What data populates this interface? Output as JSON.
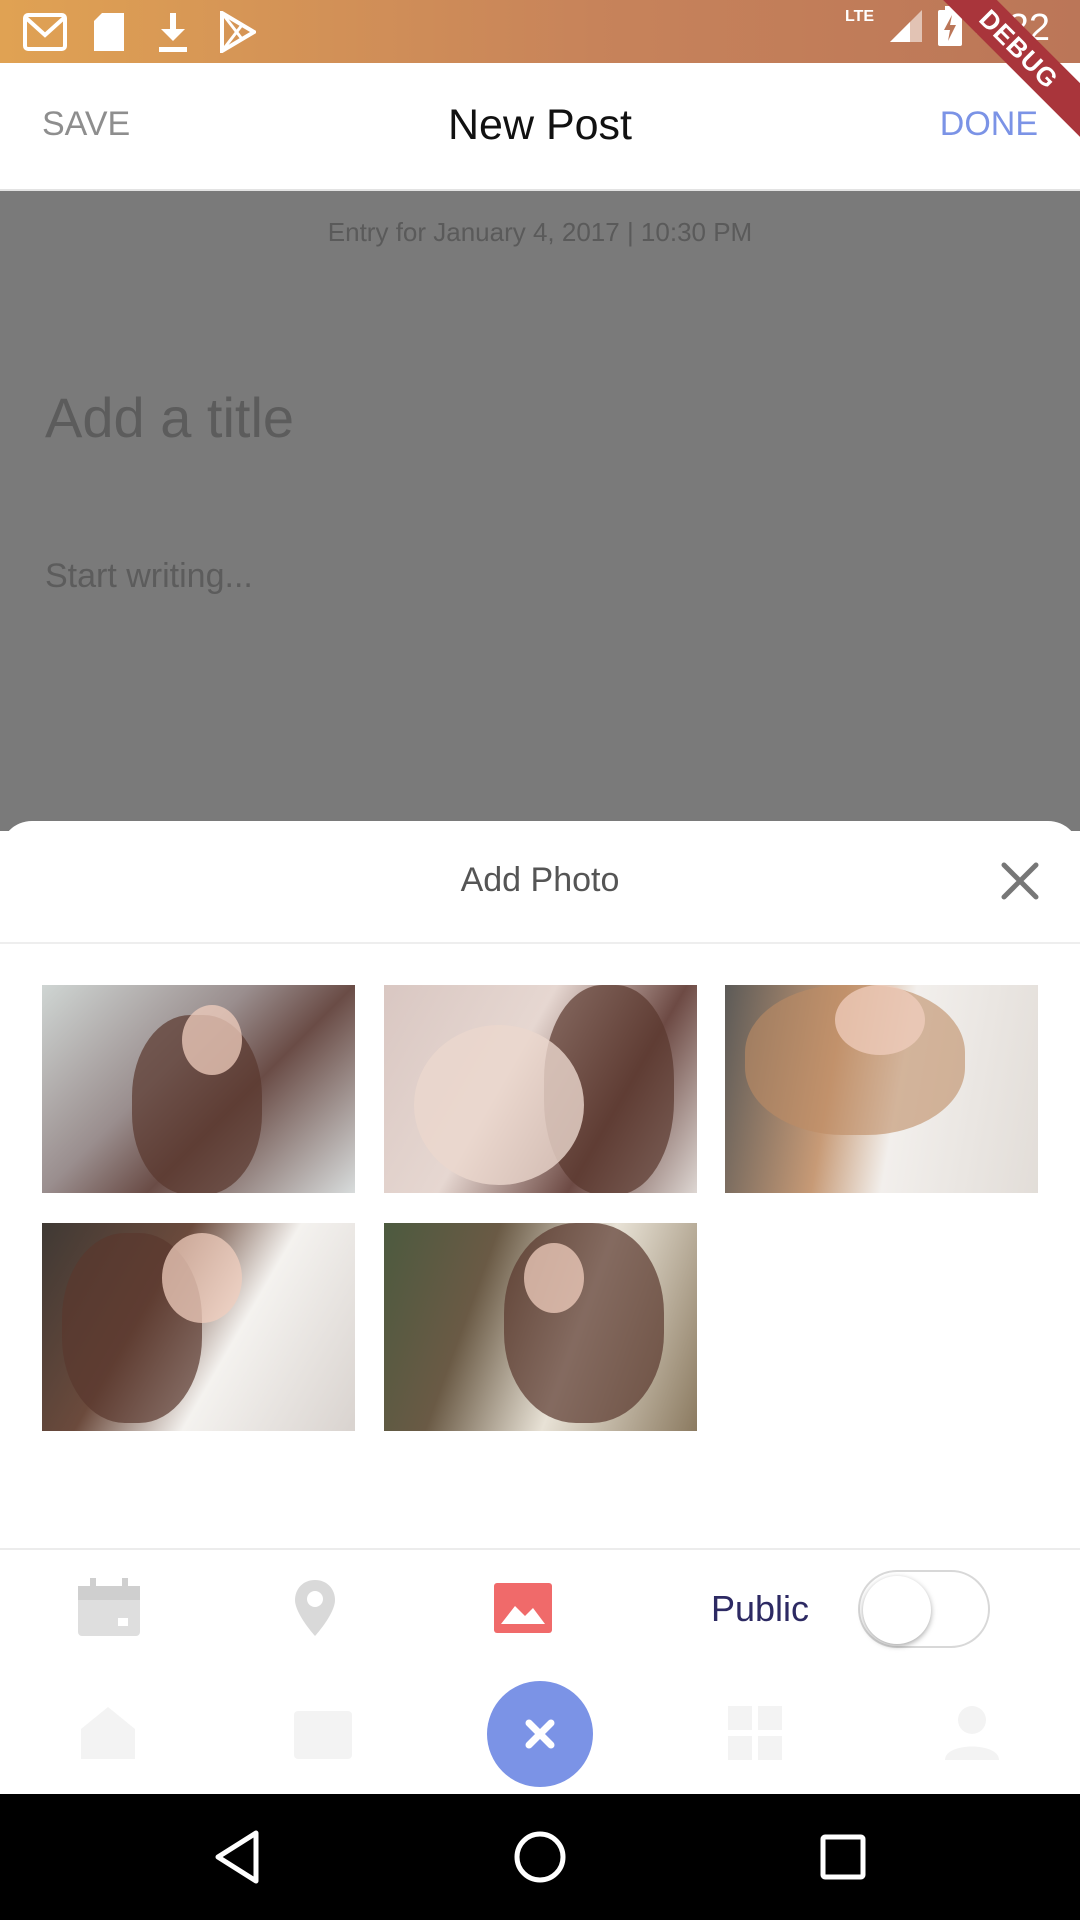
{
  "status_bar": {
    "time": "4:22",
    "network": "LTE",
    "left_icons": [
      "gmail-icon",
      "sd-card-icon",
      "download-icon",
      "play-store-icon"
    ]
  },
  "debug_banner": "DEBUG",
  "app_bar": {
    "save_label": "SAVE",
    "title": "New Post",
    "done_label": "DONE"
  },
  "editor": {
    "entry_date": "Entry for January 4, 2017 | 10:30 PM",
    "title_placeholder": "Add a title",
    "body_placeholder": "Start writing..."
  },
  "sheet": {
    "title": "Add Photo",
    "photos": [
      "photo-1",
      "photo-2",
      "photo-3",
      "photo-4",
      "photo-5"
    ]
  },
  "toolbar": {
    "public_label": "Public",
    "public_enabled": false
  },
  "colors": {
    "accent": "#7b93e6",
    "dim_overlay": "#7a7a7a",
    "public_text": "#2d2a63",
    "photo_icon": "#f06a6a"
  }
}
